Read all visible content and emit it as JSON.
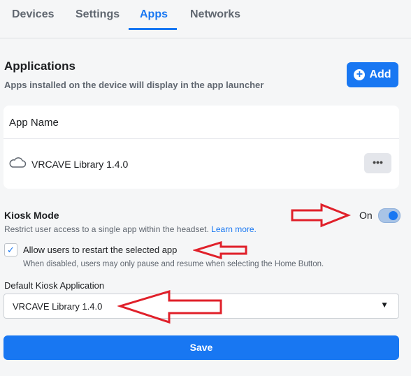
{
  "tabs": [
    "Devices",
    "Settings",
    "Apps",
    "Networks"
  ],
  "active_tab": "Apps",
  "applications": {
    "title": "Applications",
    "subtitle": "Apps installed on the device will display in the app launcher",
    "add_label": "Add",
    "table_header": "App Name",
    "apps": [
      {
        "name": "VRCAVE Library 1.4.0",
        "icon": "cloud-icon",
        "menu": "•••"
      }
    ]
  },
  "kiosk": {
    "title": "Kiosk Mode",
    "toggle_label": "On",
    "toggle_on": true,
    "description": "Restrict user access to a single app within the headset.",
    "learn_more": "Learn more.",
    "allow_restart_label": "Allow users to restart the selected app",
    "allow_restart_checked": true,
    "allow_restart_help": "When disabled, users may only pause and resume when selecting the Home Button.",
    "default_label": "Default Kiosk Application",
    "default_value": "VRCAVE Library 1.4.0"
  },
  "save_label": "Save",
  "colors": {
    "accent": "#1877f2",
    "annotation_arrow": "#e0202a",
    "background": "#f5f6f7"
  }
}
